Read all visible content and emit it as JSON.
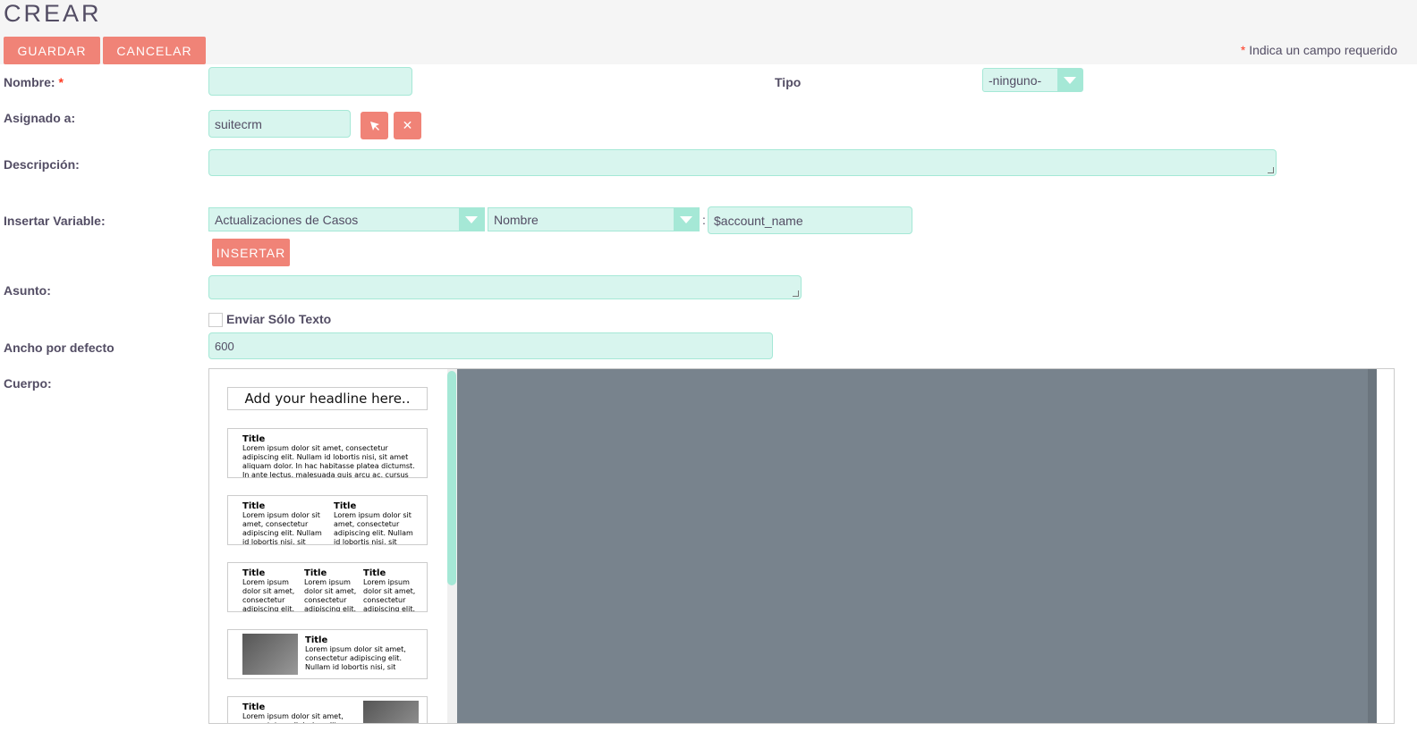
{
  "header": {
    "title": "CREAR",
    "save_label": "GUARDAR",
    "cancel_label": "CANCELAR",
    "required_star": "*",
    "required_note": "Indica un campo requerido"
  },
  "form": {
    "name_label": "Nombre:",
    "name_required": "*",
    "name_value": "",
    "type_label": "Tipo",
    "type_value": "-ninguno-",
    "assigned_label": "Asignado a:",
    "assigned_value": "suitecrm",
    "select_icon": "cursor-arrow-icon",
    "clear_icon": "close-icon",
    "clear_glyph": "✕",
    "description_label": "Descripción:",
    "description_value": "",
    "insert_var_label": "Insertar Variable:",
    "module_value": "Actualizaciones de Casos",
    "field_value": "Nombre",
    "colon": ":",
    "variable_value": "$account_name",
    "insert_label": "INSERTAR",
    "subject_label": "Asunto:",
    "subject_value": "",
    "text_only_label": "Enviar Sólo Texto",
    "text_only_checked": false,
    "width_label": "Ancho por defecto",
    "width_value": "600",
    "body_label": "Cuerpo:"
  },
  "templates": {
    "headline": "Add your headline here..",
    "title": "Title",
    "text_long": "Lorem ipsum dolor sit amet, consectetur adipiscing elit. Nullam id lobortis nisi, sit amet aliquam dolor. In hac habitasse platea dictumst. In ante lectus, malesuada quis arcu ac, cursus",
    "text_two_col": "Lorem ipsum dolor sit amet, consectetur adipiscing elit. Nullam id lobortis nisi, sit",
    "text_three_col": "Lorem ipsum dolor sit amet, consectetur adipiscing elit.",
    "text_image": "Lorem ipsum dolor sit amet, consectetur adipiscing elit. Nullam id lobortis nisi, sit",
    "text_image_right": "Lorem ipsum dolor sit amet, consectetur adipiscing elit."
  },
  "colors": {
    "accent": "#f08377",
    "field_bg": "#d8f5ee",
    "field_border": "#a5e8d6",
    "canvas": "#78838d"
  }
}
